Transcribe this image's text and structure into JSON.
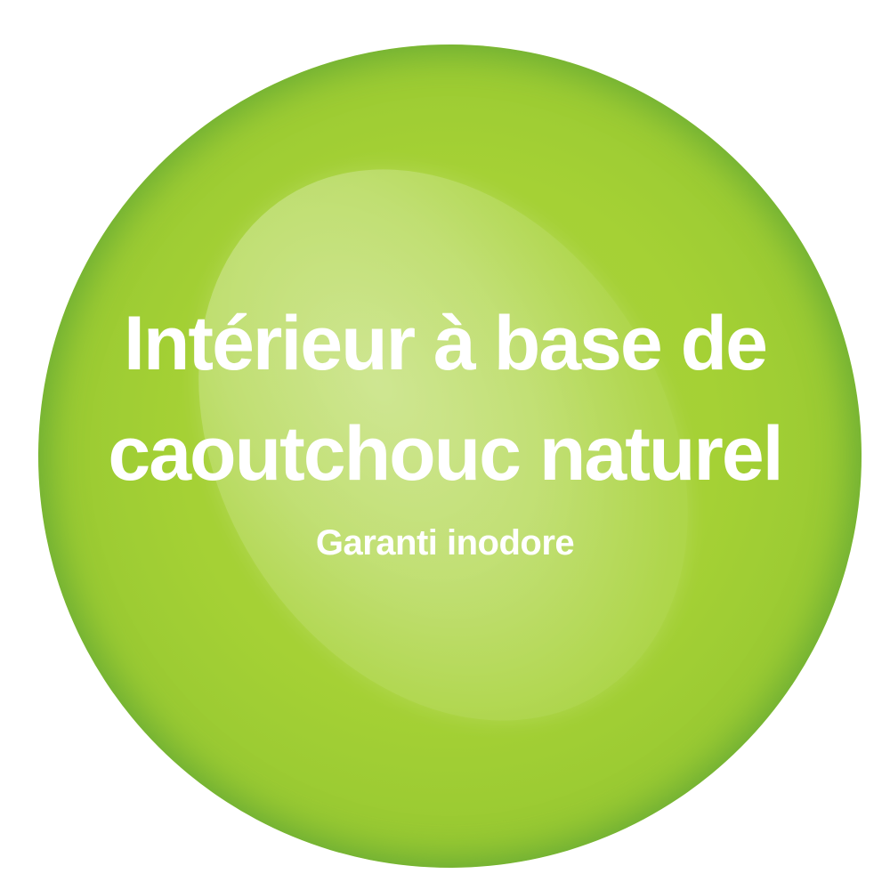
{
  "badge": {
    "headline_line1": "Intérieur à base de",
    "headline_line2": "caoutchouc naturel",
    "subtitle": "Garanti inodore",
    "colors": {
      "primary_green": "#a5d135",
      "edge_green": "#5fa83a",
      "text": "#ffffff",
      "background": "#ffffff"
    }
  }
}
